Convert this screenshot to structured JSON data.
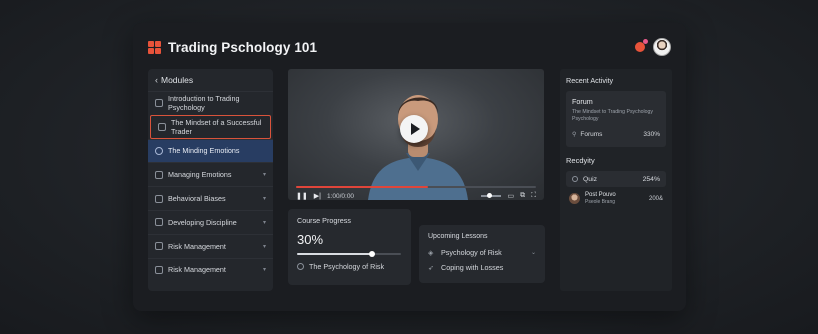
{
  "app": {
    "title": "Trading Pschology 101"
  },
  "colors": {
    "accent": "#e8533a",
    "active_bg": "#283d62",
    "progress": "#e0453a"
  },
  "sidebar": {
    "header": "Modules",
    "items": [
      {
        "label": "Introduction to Trading Psychology",
        "icon": "lock-icon"
      },
      {
        "label": "The Mindset of a Successful Trader",
        "icon": "document-icon",
        "state": "outlined"
      },
      {
        "label": "The Minding Emotions",
        "icon": "target-icon",
        "state": "active"
      },
      {
        "label": "Managing Emotions",
        "icon": "edit-icon"
      },
      {
        "label": "Behavioral Biases",
        "icon": "folder-icon"
      },
      {
        "label": "Developing Discipline",
        "icon": "lock-icon"
      },
      {
        "label": "Risk Management",
        "icon": "grid-icon"
      },
      {
        "label": "Risk Management",
        "icon": "grid-icon"
      }
    ]
  },
  "video": {
    "time": "1:00/0:00",
    "progress": 0.55
  },
  "course_progress": {
    "label": "Course Progress",
    "percent_text": "30%",
    "slider_value": 0.72,
    "item": "The Psychology of Risk"
  },
  "upcoming": {
    "label": "Upcoming Lessons",
    "items": [
      "Psychology of Risk",
      "Coping with Losses"
    ]
  },
  "recent": {
    "title": "Recent Activity",
    "forum": {
      "title": "Forum",
      "desc": "The Mindset to Trading Psychology Psychology",
      "link": "Forums",
      "value": "330%"
    },
    "section2": "Recdyity",
    "quiz": {
      "label": "Quiz",
      "value": "254%"
    },
    "user": {
      "name": "Post Pouvo",
      "sub": "Pseole Brang",
      "value": "200&"
    }
  }
}
